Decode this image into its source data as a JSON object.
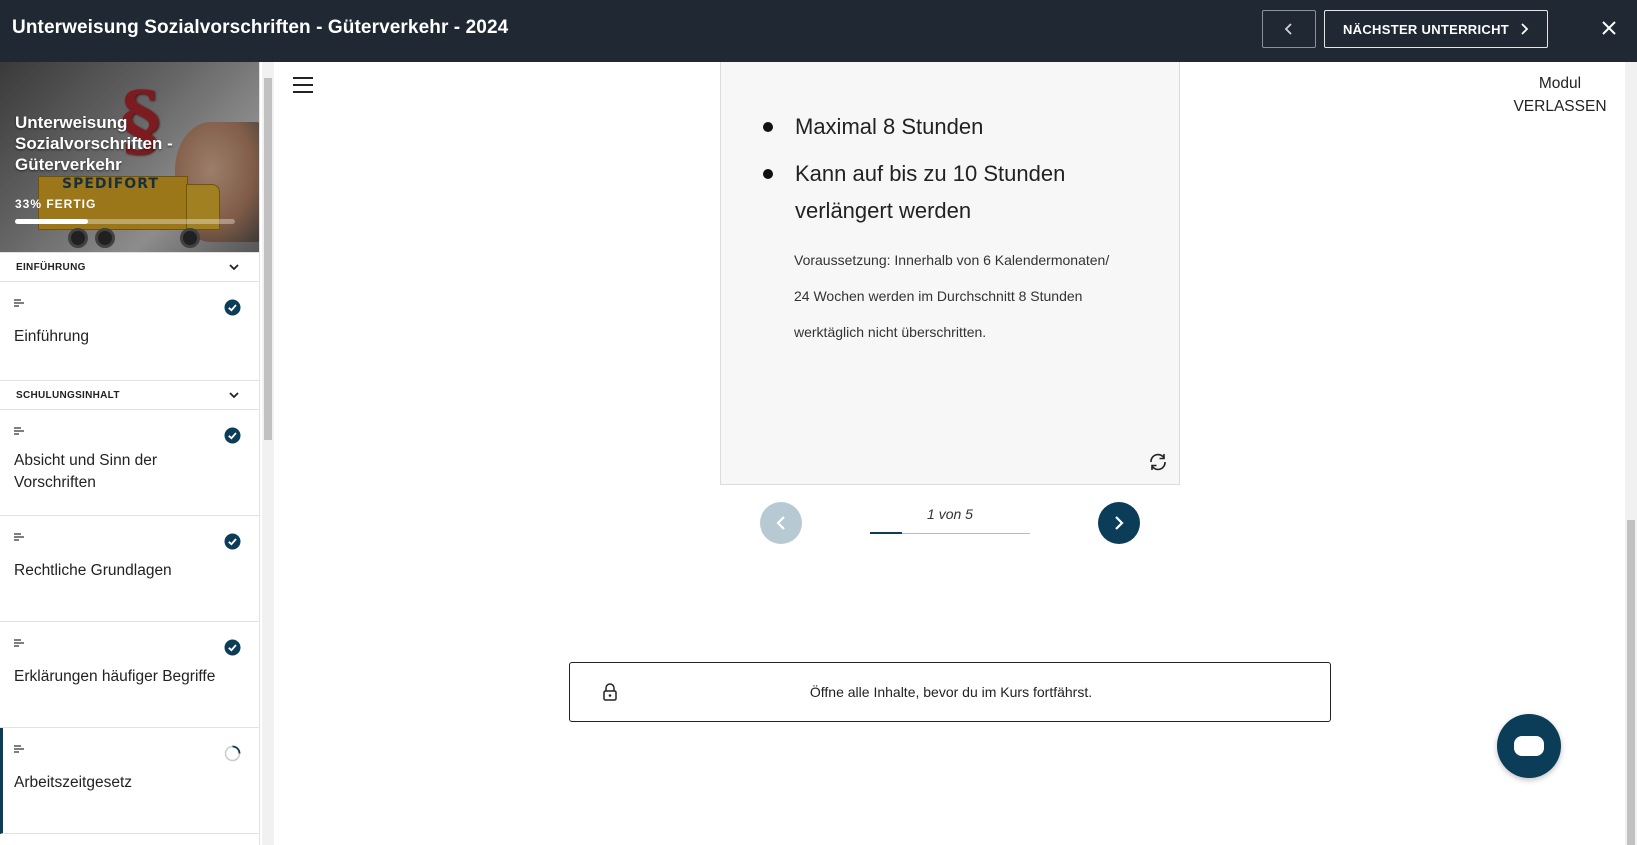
{
  "header": {
    "title": "Unterweisung Sozialvorschriften - Güterverkehr - 2024",
    "next_lesson_label": "NÄCHSTER UNTERRICHT"
  },
  "sidebar": {
    "course_title": "Unterweisung Sozialvorschriften - Güterverkehr",
    "logo_text": "SPEDIFORT",
    "progress_label": "33% FERTIG",
    "progress_fraction": 0.33,
    "sections": [
      {
        "label": "EINFÜHRUNG",
        "lessons": [
          {
            "label": "Einführung",
            "status": "complete"
          }
        ]
      },
      {
        "label": "SCHULUNGSINHALT",
        "lessons": [
          {
            "label": "Absicht und Sinn der Vorschriften",
            "status": "complete"
          },
          {
            "label": "Rechtliche Grundlagen",
            "status": "complete"
          },
          {
            "label": "Erklärungen häufiger Begriffe",
            "status": "complete"
          },
          {
            "label": "Arbeitszeitgesetz",
            "status": "in-progress"
          }
        ]
      }
    ]
  },
  "main": {
    "exit_line1": "Modul",
    "exit_line2": "VERLASSEN",
    "card": {
      "bullet1": "Maximal 8 Stunden",
      "bullet2": "Kann auf bis zu 10 Stunden verlängert werden",
      "note": "Voraussetzung: Innerhalb von 6 Kalendermonaten/ 24 Wochen werden im Durchschnitt 8 Stunden werktäglich nicht überschritten."
    },
    "pager": {
      "counter": "1 von 5",
      "current": 1,
      "total": 5
    },
    "lock_message": "Öffne alle Inhalte, bevor du im Kurs fortfährst."
  },
  "colors": {
    "topbar_bg": "#1f2833",
    "accent": "#0b3d58",
    "disabled_nav": "#b7c9d3"
  }
}
